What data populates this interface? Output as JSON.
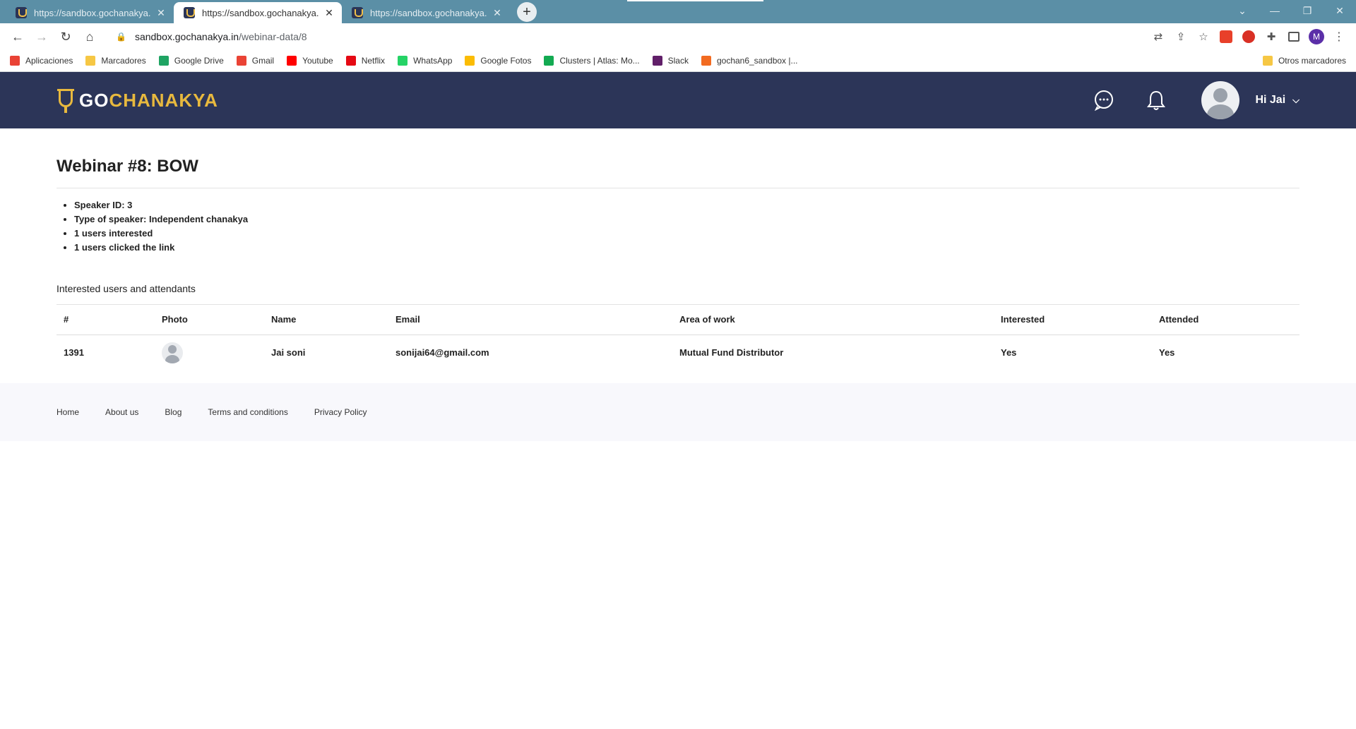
{
  "browser": {
    "tabs": [
      {
        "title": "https://sandbox.gochanakya.in/m"
      },
      {
        "title": "https://sandbox.gochanakya.in/w"
      },
      {
        "title": "https://sandbox.gochanakya.in/w"
      }
    ],
    "new_tab_label": "+",
    "url_host": "sandbox.gochanakya.in",
    "url_path": "/webinar-data/8",
    "profile_initial": "M",
    "bookmarks": [
      {
        "label": "Aplicaciones",
        "color": "#e94235"
      },
      {
        "label": "Marcadores",
        "color": "#f6c744"
      },
      {
        "label": "Google Drive",
        "color": "#1fa463"
      },
      {
        "label": "Gmail",
        "color": "#ea4335"
      },
      {
        "label": "Youtube",
        "color": "#ff0000"
      },
      {
        "label": "Netflix",
        "color": "#e50914"
      },
      {
        "label": "WhatsApp",
        "color": "#25d366"
      },
      {
        "label": "Google Fotos",
        "color": "#fbbc04"
      },
      {
        "label": "Clusters | Atlas: Mo...",
        "color": "#13aa52"
      },
      {
        "label": "Slack",
        "color": "#611f69"
      },
      {
        "label": "gochan6_sandbox |...",
        "color": "#f26b21"
      }
    ],
    "other_bookmarks": "Otros marcadores"
  },
  "header": {
    "logo_go": "GO",
    "logo_chanakya": "CHANAKYA",
    "greeting": "Hi Jai",
    "brand_color": "#2c3558",
    "accent_color": "#e8b93e"
  },
  "webinar": {
    "title": "Webinar #8: BOW",
    "stats": [
      "Speaker ID: 3",
      "Type of speaker: Independent chanakya",
      "1 users interested",
      "1 users clicked the link"
    ]
  },
  "attendants": {
    "section_title": "Interested users and attendants",
    "columns": [
      "#",
      "Photo",
      "Name",
      "Email",
      "Area of work",
      "Interested",
      "Attended"
    ],
    "rows": [
      {
        "id": "1391",
        "name": "Jai soni",
        "email": "sonijai64@gmail.com",
        "area": "Mutual Fund Distributor",
        "interested": "Yes",
        "attended": "Yes"
      }
    ]
  },
  "footer": {
    "links": [
      "Home",
      "About us",
      "Blog",
      "Terms and conditions",
      "Privacy Policy"
    ]
  }
}
